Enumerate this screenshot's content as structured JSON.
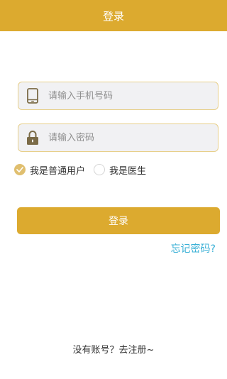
{
  "header": {
    "title": "登录"
  },
  "form": {
    "phone": {
      "placeholder": "请输入手机号码",
      "value": "",
      "icon": "phone-icon"
    },
    "password": {
      "placeholder": "请输入密码",
      "value": "",
      "icon": "lock-icon"
    },
    "roles": [
      {
        "label": "我是普通用户",
        "selected": true
      },
      {
        "label": "我是医生",
        "selected": false
      }
    ],
    "login_label": "登录",
    "forgot_label": "忘记密码?"
  },
  "footer": {
    "register_label": "没有账号？去注册~"
  },
  "colors": {
    "accent": "#dcaa2f",
    "link": "#3ab0d6"
  }
}
